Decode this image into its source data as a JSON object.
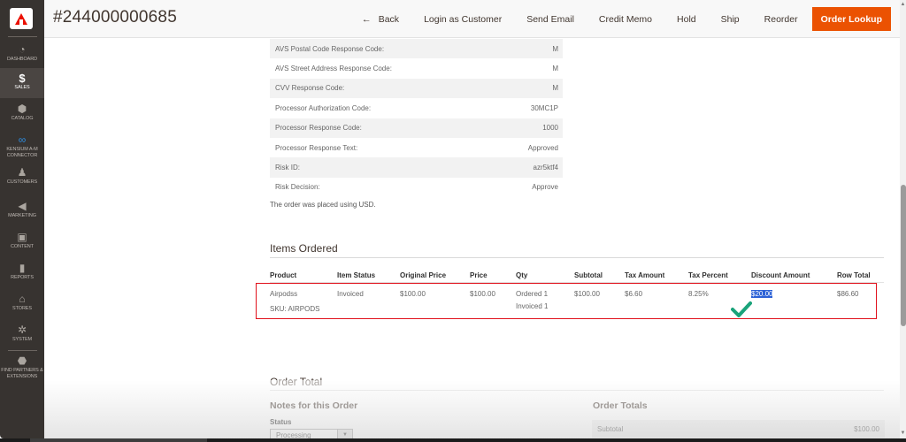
{
  "sidebar": {
    "logo": "adobe-commerce-logo",
    "items": [
      {
        "label": "DASHBOARD",
        "icon": "dashboard-icon",
        "glyph": "◔"
      },
      {
        "label": "SALES",
        "icon": "dollar-icon",
        "glyph": "$"
      },
      {
        "label": "CATALOG",
        "icon": "box-icon",
        "glyph": "⬢"
      },
      {
        "label": "KENSIUM A-M CONNECTOR",
        "icon": "chain-link-icon",
        "glyph": "∞"
      },
      {
        "label": "CUSTOMERS",
        "icon": "person-icon",
        "glyph": "♟"
      },
      {
        "label": "MARKETING",
        "icon": "megaphone-icon",
        "glyph": "◀"
      },
      {
        "label": "CONTENT",
        "icon": "layout-icon",
        "glyph": "▣"
      },
      {
        "label": "REPORTS",
        "icon": "bar-chart-icon",
        "glyph": "▮"
      },
      {
        "label": "STORES",
        "icon": "storefront-icon",
        "glyph": "⌂"
      },
      {
        "label": "SYSTEM",
        "icon": "gear-icon",
        "glyph": "✲"
      },
      {
        "label": "FIND PARTNERS & EXTENSIONS",
        "icon": "cube-icon",
        "glyph": "⬣"
      }
    ],
    "active_index": 1
  },
  "header": {
    "title": "#244000000685",
    "back_arrow": "←",
    "actions": [
      "Back",
      "Login as Customer",
      "Send Email",
      "Credit Memo",
      "Hold",
      "Ship",
      "Reorder"
    ],
    "primary_action": "Order Lookup"
  },
  "payment_info": [
    {
      "label": "AVS Postal Code Response Code:",
      "value": "M"
    },
    {
      "label": "AVS Street Address Response Code:",
      "value": "M"
    },
    {
      "label": "CVV Response Code:",
      "value": "M"
    },
    {
      "label": "Processor Authorization Code:",
      "value": "30MC1P"
    },
    {
      "label": "Processor Response Code:",
      "value": "1000"
    },
    {
      "label": "Processor Response Text:",
      "value": "Approved"
    },
    {
      "label": "Risk ID:",
      "value": "azr5ktf4"
    },
    {
      "label": "Risk Decision:",
      "value": "Approve"
    }
  ],
  "currency_note": "The order was placed using USD.",
  "items_ordered": {
    "title": "Items Ordered",
    "columns": [
      "Product",
      "Item Status",
      "Original Price",
      "Price",
      "Qty",
      "Subtotal",
      "Tax Amount",
      "Tax Percent",
      "Discount Amount",
      "Row Total"
    ],
    "rows": [
      {
        "product": "Airpodss",
        "sku": "SKU: AIRPODS",
        "item_status": "Invoiced",
        "original_price": "$100.00",
        "price": "$100.00",
        "qty_ordered": "Ordered 1",
        "qty_invoiced": "Invoiced 1",
        "subtotal": "$100.00",
        "tax_amount": "$6.60",
        "tax_percent": "8.25%",
        "discount_amount": "$20.00",
        "row_total": "$86.60"
      }
    ],
    "highlight_color": "#e0101b",
    "checkmark_color": "#1aa37a"
  },
  "order_total": {
    "title": "Order Total",
    "notes_title": "Notes for this Order",
    "status_label": "Status",
    "status_value": "Processing",
    "totals_title": "Order Totals",
    "totals": [
      {
        "label": "Subtotal",
        "value": "$100.00"
      }
    ]
  },
  "colors": {
    "primary_button": "#eb5202",
    "sidebar_bg": "#373330"
  }
}
